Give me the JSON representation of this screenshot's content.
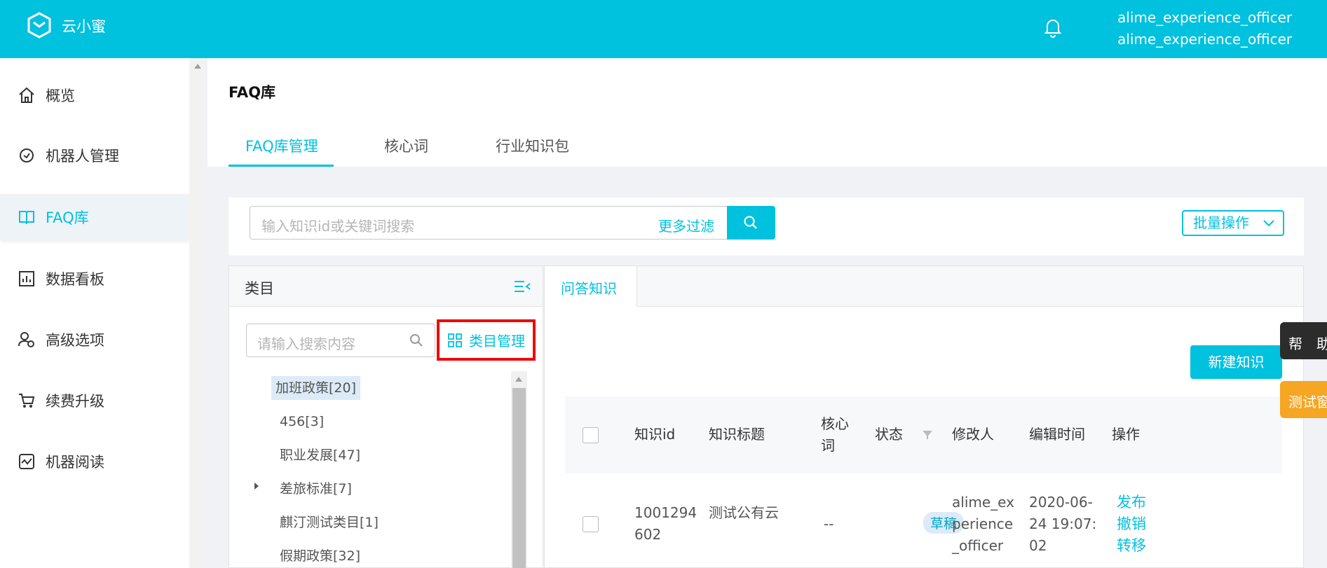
{
  "header": {
    "brand": "云小蜜",
    "user_line1": "alime_experience_officer",
    "user_line2": "alime_experience_officer"
  },
  "sidebar": {
    "items": [
      {
        "label": "概览",
        "icon": "home-icon"
      },
      {
        "label": "机器人管理",
        "icon": "robot-icon"
      },
      {
        "label": "FAQ库",
        "icon": "book-icon",
        "active": true
      },
      {
        "label": "数据看板",
        "icon": "dashboard-icon"
      },
      {
        "label": "高级选项",
        "icon": "users-settings-icon"
      },
      {
        "label": "续费升级",
        "icon": "cart-icon"
      },
      {
        "label": "机器阅读",
        "icon": "reading-icon"
      }
    ]
  },
  "page": {
    "title": "FAQ库",
    "tabs": [
      "FAQ库管理",
      "核心词",
      "行业知识包"
    ]
  },
  "search": {
    "placeholder": "输入知识id或关键词搜索",
    "more_filters": "更多过滤",
    "batch_label": "批量操作"
  },
  "category": {
    "title": "类目",
    "search_placeholder": "请输入搜索内容",
    "manage_label": "类目管理",
    "items": [
      "加班政策[20]",
      "456[3]",
      "职业发展[47]",
      "差旅标准[7]",
      "麒汀测试类目[1]",
      "假期政策[32]"
    ]
  },
  "main": {
    "tab": "问答知识",
    "new_button": "新建知识",
    "columns": {
      "id": "知识id",
      "title": "知识标题",
      "core_line1": "核心",
      "core_line2": "词",
      "status": "状态",
      "modifier": "修改人",
      "edit_time": "编辑时间",
      "ops": "操作"
    },
    "row": {
      "id_line1": "1001294",
      "id_line2": "602",
      "title": "测试公有云",
      "core": "--",
      "status": "草稿",
      "modifier_line1": "alime_ex",
      "modifier_line2": "perience",
      "modifier_line3": "_officer",
      "time_line1": "2020-06-",
      "time_line2": "24 19:07:",
      "time_line3": "02",
      "actions": [
        "发布",
        "撤销",
        "转移"
      ]
    }
  },
  "floating": {
    "help": "帮助",
    "test": "测试窗"
  },
  "colors": {
    "accent": "#00c1de",
    "highlight_border": "#ee0a0a",
    "test_widget": "#f5a623"
  }
}
